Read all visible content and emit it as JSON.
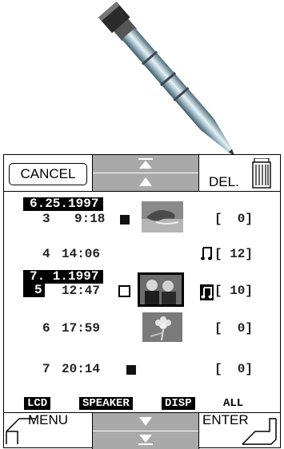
{
  "toolbar": {
    "cancel_label": "CANCEL",
    "delete_label": "DEL."
  },
  "entries": [
    {
      "index": "3",
      "time": "9:18",
      "marker": "filled-square",
      "count": "[  0]"
    },
    {
      "index": "4",
      "time": "14:06",
      "marker": "none",
      "count": "[ 12]",
      "icon": "music-note-icon"
    },
    {
      "index": "5",
      "time": "12:47",
      "marker": "empty-square",
      "count": "[ 10]",
      "icon": "music-note-selected-icon",
      "selected": true
    },
    {
      "index": "6",
      "time": "17:59",
      "marker": "none",
      "count": "[  0]"
    },
    {
      "index": "7",
      "time": "20:14",
      "marker": "filled-square",
      "count": "[  0]"
    }
  ],
  "dates": [
    "6.25.1997",
    "7. 1.1997"
  ],
  "modes": [
    "LCD",
    "SPEAKER",
    "DISP",
    "ALL"
  ],
  "footer": {
    "menu_label": "MENU",
    "enter_label": "ENTER"
  }
}
